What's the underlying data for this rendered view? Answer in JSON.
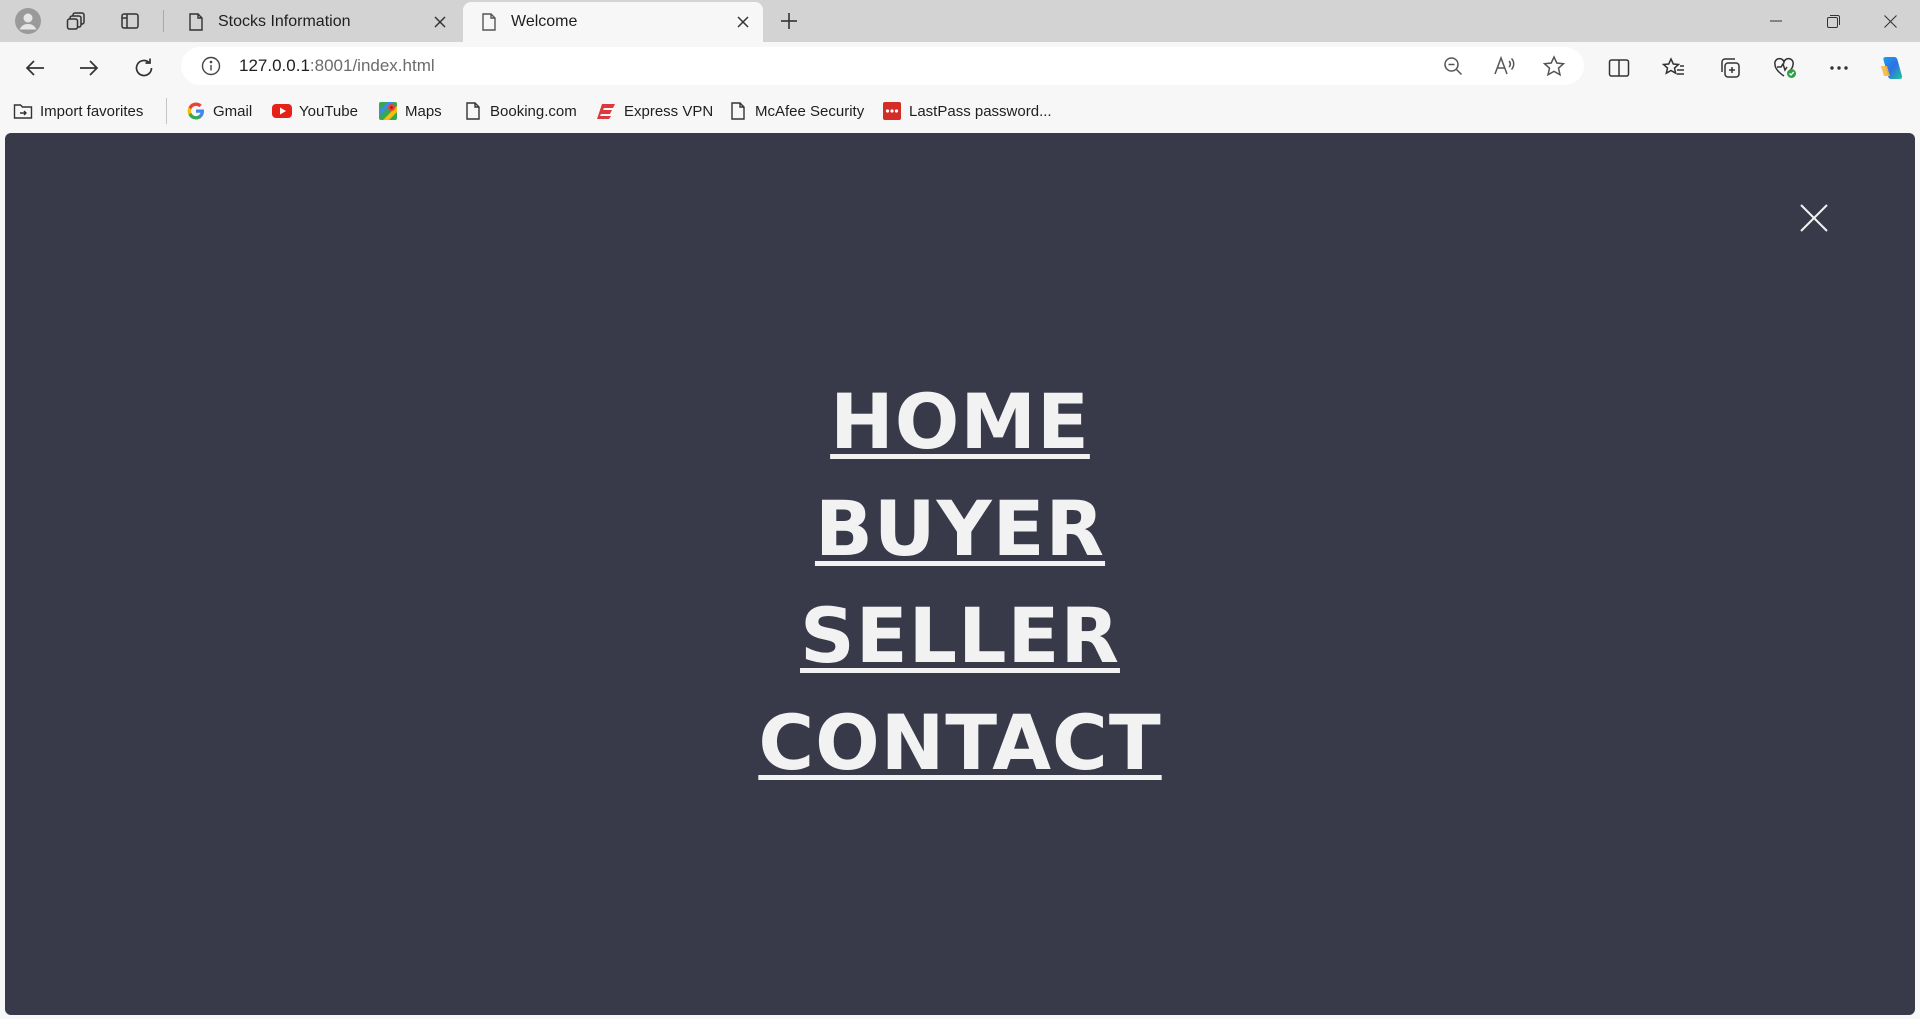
{
  "browser": {
    "tabs": [
      {
        "label": "Stocks Information",
        "active": false
      },
      {
        "label": "Welcome",
        "active": true
      }
    ],
    "address": {
      "host": "127.0.0.1",
      "path": ":8001/index.html"
    },
    "bookmarks": [
      {
        "label": "Import favorites",
        "icon": "import-favorites-icon"
      },
      {
        "label": "Gmail",
        "icon": "google-icon"
      },
      {
        "label": "YouTube",
        "icon": "youtube-icon"
      },
      {
        "label": "Maps",
        "icon": "maps-icon"
      },
      {
        "label": "Booking.com",
        "icon": "page-icon"
      },
      {
        "label": "Express VPN",
        "icon": "expressvpn-icon"
      },
      {
        "label": "McAfee Security",
        "icon": "page-icon"
      },
      {
        "label": "LastPass password...",
        "icon": "lastpass-icon"
      }
    ]
  },
  "page": {
    "background": "#383a4a",
    "menu": [
      {
        "label": "HOME"
      },
      {
        "label": "BUYER"
      },
      {
        "label": "SELLER"
      },
      {
        "label": "CONTACT"
      }
    ]
  }
}
